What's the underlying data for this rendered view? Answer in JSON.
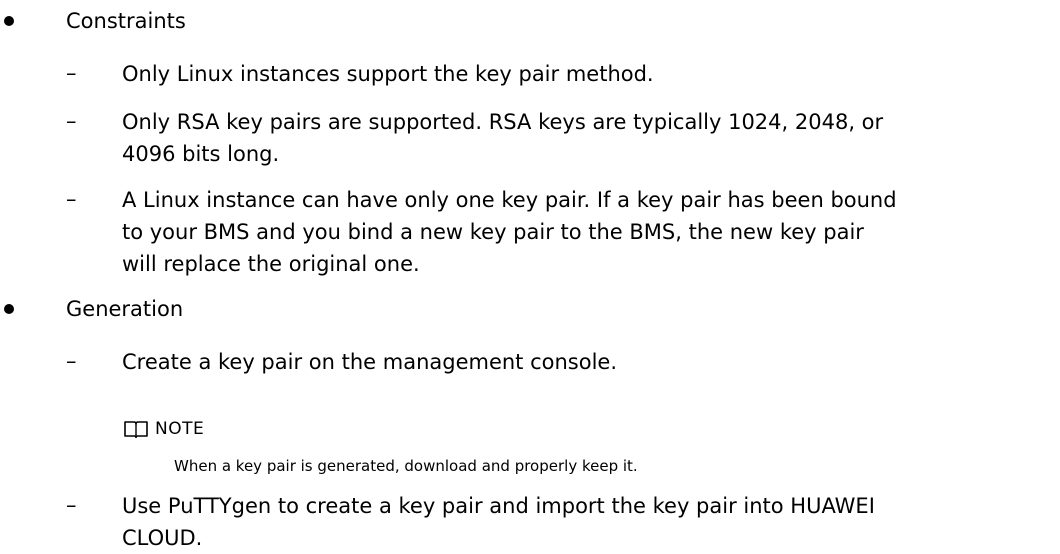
{
  "sections": [
    {
      "heading": "Constraints",
      "items": [
        "Only Linux instances support the key pair method.",
        "Only RSA key pairs are supported. RSA keys are typically 1024, 2048, or\n4096 bits long.",
        "A Linux instance can have only one key pair. If a key pair has been bound\nto your BMS and you bind a new key pair to the BMS, the new key pair\nwill replace the original one."
      ]
    },
    {
      "heading": "Generation",
      "items": [
        "Create a key pair on the management console.",
        "Use PuTTYgen to create a key pair and import the key pair into HUAWEI\nCLOUD."
      ]
    }
  ],
  "bullet_symbol": "●",
  "dash_symbol": "–",
  "note": {
    "label": "NOTE",
    "icon": "book-icon",
    "text": "When a key pair is generated, download and properly keep it."
  }
}
